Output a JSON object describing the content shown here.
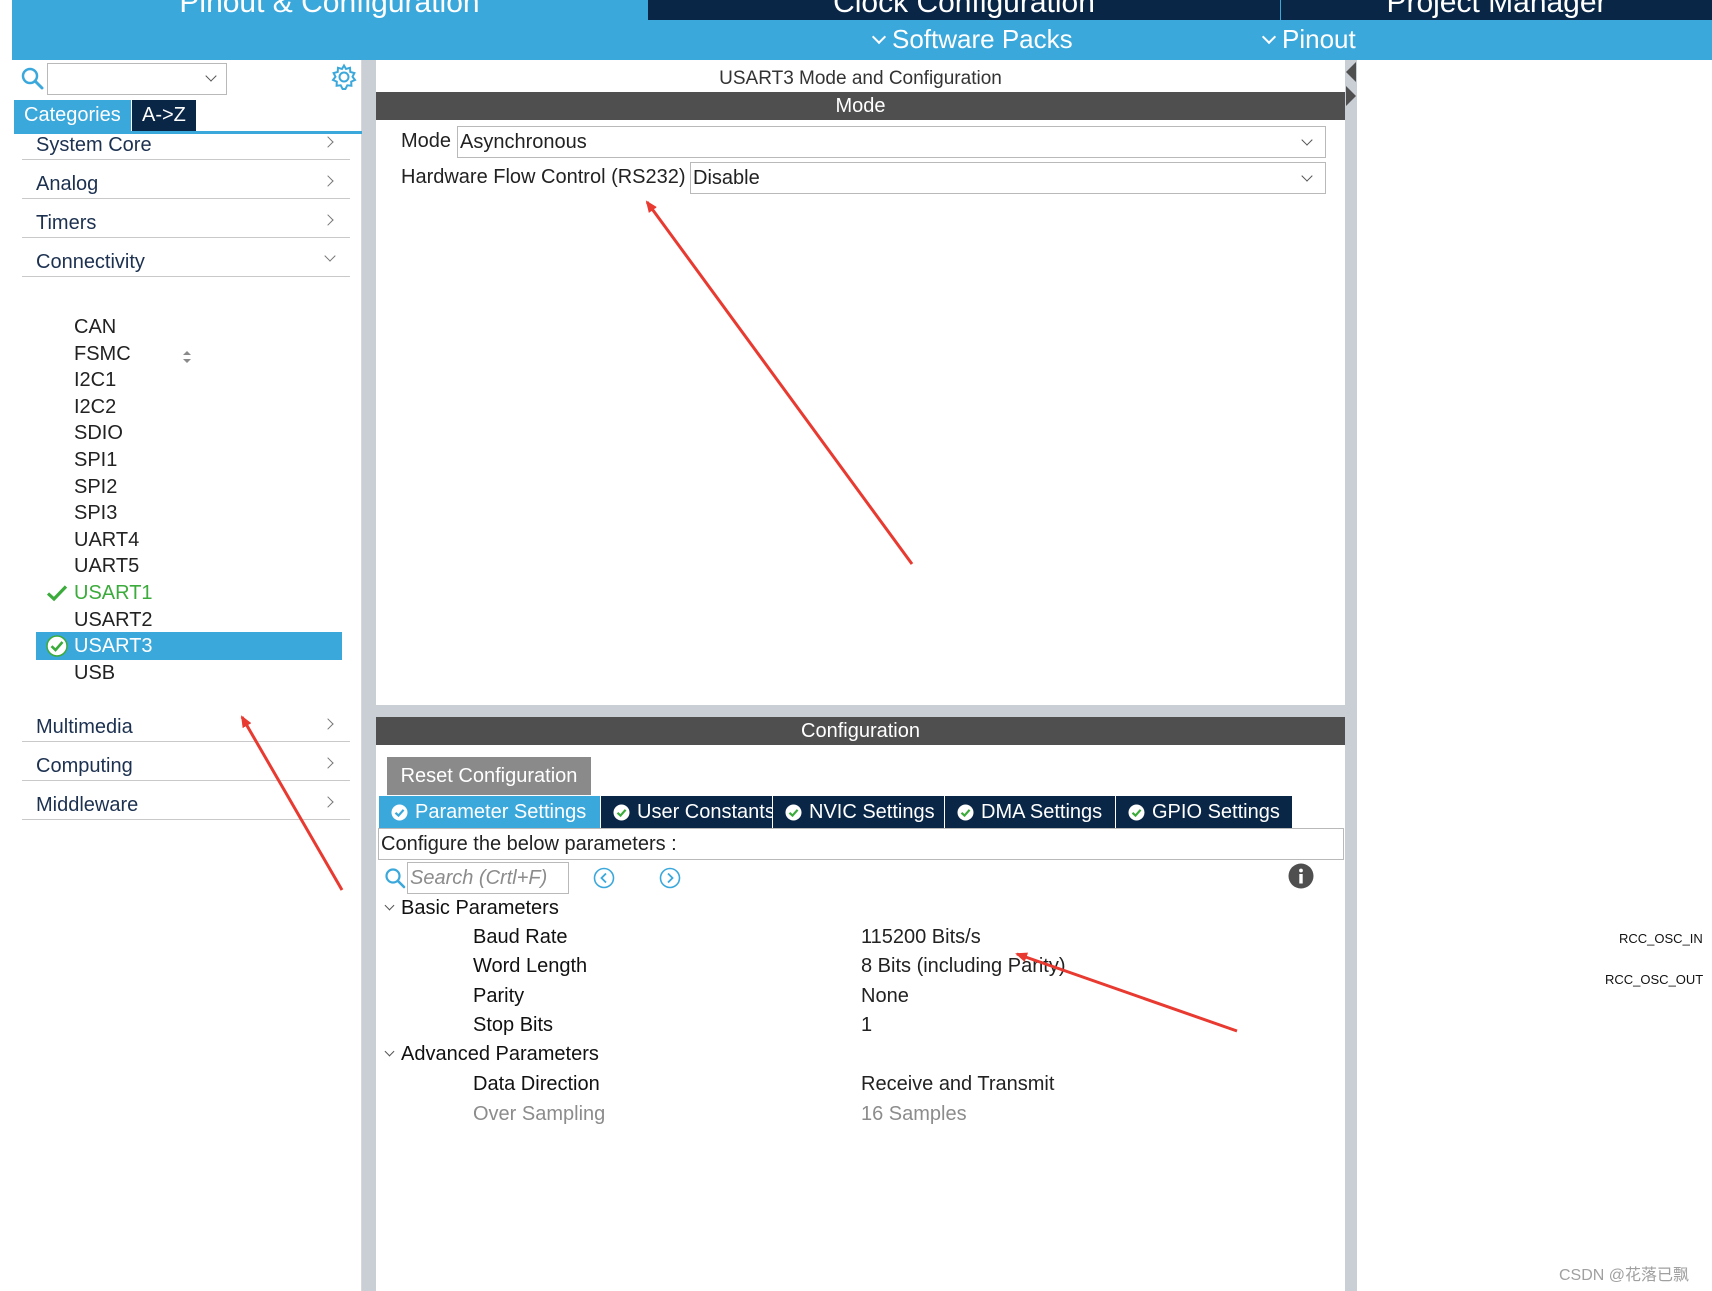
{
  "topbar": {
    "tabs": [
      {
        "label": "Pinout & Configuration"
      },
      {
        "label": "Clock Configuration"
      },
      {
        "label": "Project Manager"
      }
    ],
    "menus": [
      {
        "label": "Software Packs"
      },
      {
        "label": "Pinout"
      }
    ]
  },
  "sidebar": {
    "search": {
      "value": ""
    },
    "view_tabs": [
      {
        "label": "Categories"
      },
      {
        "label": "A->Z"
      }
    ],
    "categories": [
      {
        "label": "System Core"
      },
      {
        "label": "Analog"
      },
      {
        "label": "Timers"
      },
      {
        "label": "Connectivity"
      },
      {
        "label": "Multimedia"
      },
      {
        "label": "Computing"
      },
      {
        "label": "Middleware"
      }
    ],
    "connectivity_items": [
      {
        "label": "CAN",
        "state": "none"
      },
      {
        "label": "FSMC",
        "state": "none"
      },
      {
        "label": "I2C1",
        "state": "none"
      },
      {
        "label": "I2C2",
        "state": "none"
      },
      {
        "label": "SDIO",
        "state": "none"
      },
      {
        "label": "SPI1",
        "state": "none"
      },
      {
        "label": "SPI2",
        "state": "none"
      },
      {
        "label": "SPI3",
        "state": "none"
      },
      {
        "label": "UART4",
        "state": "none"
      },
      {
        "label": "UART5",
        "state": "none"
      },
      {
        "label": "USART1",
        "state": "enabled"
      },
      {
        "label": "USART2",
        "state": "none"
      },
      {
        "label": "USART3",
        "state": "selected"
      },
      {
        "label": "USB",
        "state": "none"
      }
    ]
  },
  "mode_panel": {
    "title": "USART3 Mode and Configuration",
    "section_label": "Mode",
    "fields": [
      {
        "label": "Mode",
        "value": "Asynchronous"
      },
      {
        "label": "Hardware Flow Control (RS232)",
        "value": "Disable"
      }
    ]
  },
  "config_panel": {
    "section_label": "Configuration",
    "reset_label": "Reset Configuration",
    "tabs": [
      {
        "label": "Parameter Settings",
        "active": true
      },
      {
        "label": "User Constants",
        "active": false
      },
      {
        "label": "NVIC Settings",
        "active": false
      },
      {
        "label": "DMA Settings",
        "active": false
      },
      {
        "label": "GPIO Settings",
        "active": false
      }
    ],
    "info_text": "Configure the below parameters :",
    "search_placeholder": "Search (Crtl+F)",
    "groups": [
      {
        "name": "Basic Parameters",
        "params": [
          {
            "name": "Baud Rate",
            "value": "115200 Bits/s"
          },
          {
            "name": "Word Length",
            "value": "8 Bits (including Parity)"
          },
          {
            "name": "Parity",
            "value": "None"
          },
          {
            "name": "Stop Bits",
            "value": "1"
          }
        ]
      },
      {
        "name": "Advanced Parameters",
        "params": [
          {
            "name": "Data Direction",
            "value": "Receive and Transmit"
          },
          {
            "name": "Over Sampling",
            "value": "16 Samples"
          }
        ]
      }
    ]
  },
  "pinout_view": {
    "pins": [
      "RCC_OSC_IN",
      "RCC_OSC_OUT"
    ]
  },
  "watermark": "CSDN @花落已飘",
  "colors": {
    "accent_blue": "#3ba8dc",
    "navy": "#0a2647",
    "section_bar": "#4f4f4f",
    "enabled_green": "#3bab3b",
    "annotation_red": "#e83a30"
  }
}
